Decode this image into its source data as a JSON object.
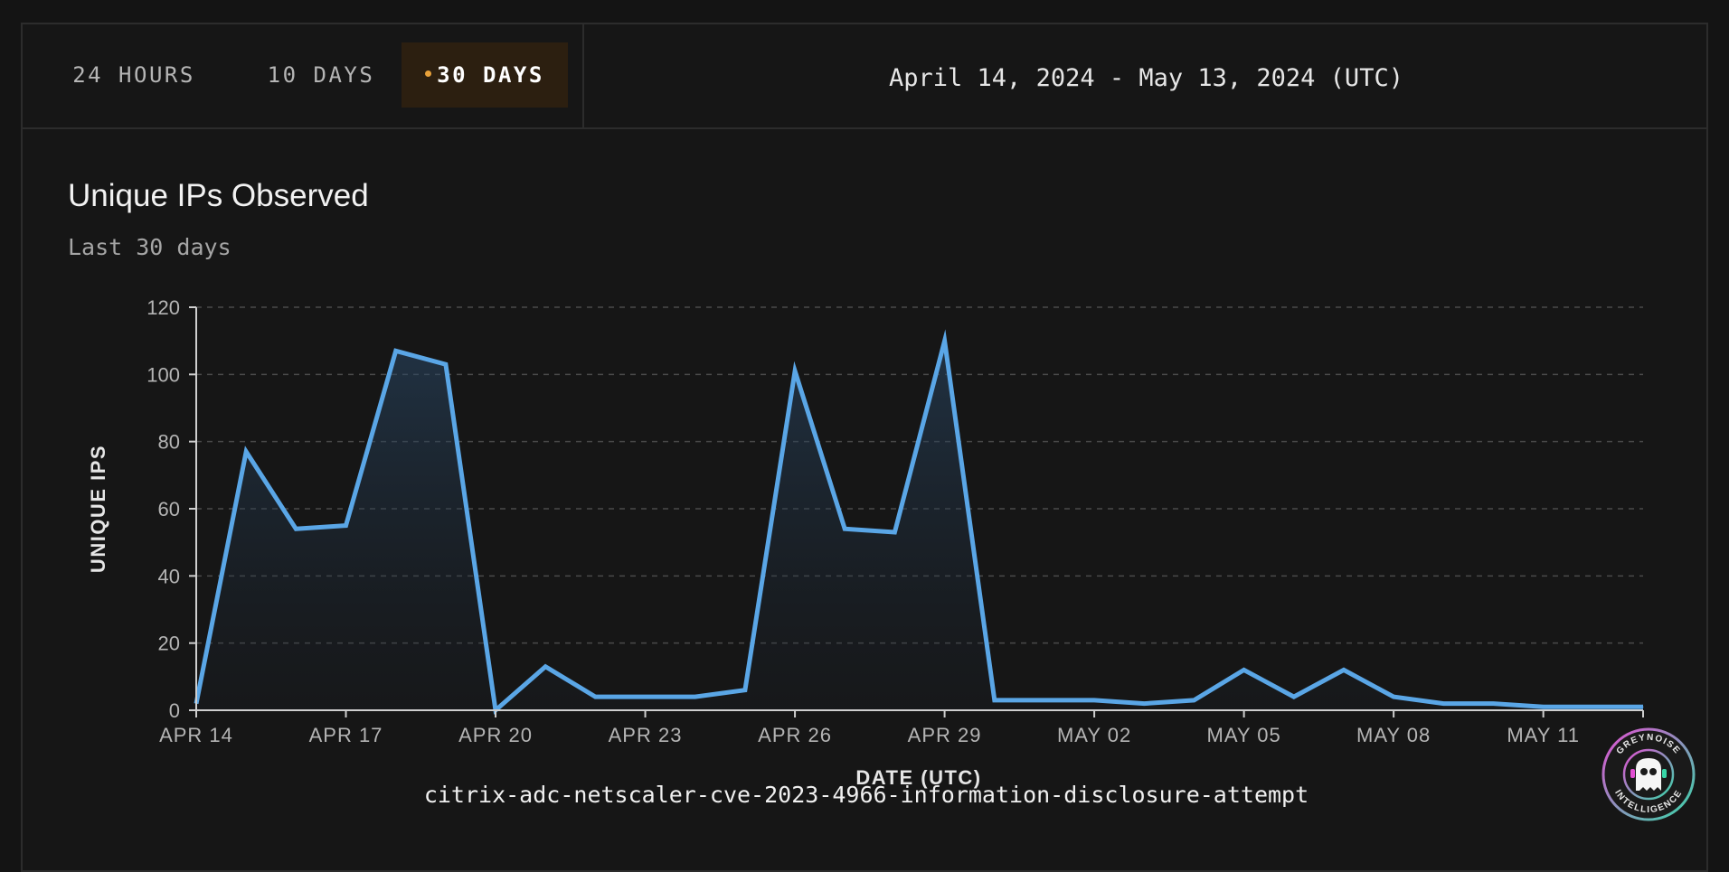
{
  "tabs": [
    {
      "label": "24 HOURS",
      "active": false
    },
    {
      "label": "10 DAYS",
      "active": false
    },
    {
      "label": "30 DAYS",
      "active": true
    }
  ],
  "date_range": "April 14, 2024 - May 13, 2024 (UTC)",
  "colors": {
    "accent": "#e8a13a",
    "line": "#5aa6e6",
    "grid": "#4a4a4a",
    "background": "#161616"
  },
  "logo": {
    "icon": "ghost-icon",
    "text_top": "GREYNOISE",
    "text_bottom": "INTELLIGENCE"
  },
  "chart_data": {
    "type": "area",
    "title": "Unique IPs Observed",
    "subtitle": "Last 30 days",
    "xlabel": "DATE (UTC)",
    "ylabel": "UNIQUE IPS",
    "series_caption": "citrix-adc-netscaler-cve-2023-4966-information-disclosure-attempt",
    "ylim": [
      0,
      120
    ],
    "yticks": [
      0,
      20,
      40,
      60,
      80,
      100,
      120
    ],
    "grid": true,
    "x_start": "2024-04-14",
    "x_end": "2024-05-13",
    "xticks": [
      {
        "date": "2024-04-14",
        "label": "APR 14"
      },
      {
        "date": "2024-04-17",
        "label": "APR 17"
      },
      {
        "date": "2024-04-20",
        "label": "APR 20"
      },
      {
        "date": "2024-04-23",
        "label": "APR 23"
      },
      {
        "date": "2024-04-26",
        "label": "APR 26"
      },
      {
        "date": "2024-04-29",
        "label": "APR 29"
      },
      {
        "date": "2024-05-02",
        "label": "MAY 02"
      },
      {
        "date": "2024-05-05",
        "label": "MAY 05"
      },
      {
        "date": "2024-05-08",
        "label": "MAY 08"
      },
      {
        "date": "2024-05-11",
        "label": "MAY 11"
      }
    ],
    "points": [
      {
        "date": "2024-04-14",
        "value": 2
      },
      {
        "date": "2024-04-15",
        "value": 77
      },
      {
        "date": "2024-04-16",
        "value": 54
      },
      {
        "date": "2024-04-17",
        "value": 55
      },
      {
        "date": "2024-04-18",
        "value": 107
      },
      {
        "date": "2024-04-19",
        "value": 103
      },
      {
        "date": "2024-04-20",
        "value": 0
      },
      {
        "date": "2024-04-21",
        "value": 13
      },
      {
        "date": "2024-04-22",
        "value": 4
      },
      {
        "date": "2024-04-23",
        "value": 4
      },
      {
        "date": "2024-04-24",
        "value": 4
      },
      {
        "date": "2024-04-25",
        "value": 6
      },
      {
        "date": "2024-04-26",
        "value": 101
      },
      {
        "date": "2024-04-27",
        "value": 54
      },
      {
        "date": "2024-04-28",
        "value": 53
      },
      {
        "date": "2024-04-29",
        "value": 110
      },
      {
        "date": "2024-04-30",
        "value": 3
      },
      {
        "date": "2024-05-01",
        "value": 3
      },
      {
        "date": "2024-05-02",
        "value": 3
      },
      {
        "date": "2024-05-03",
        "value": 2
      },
      {
        "date": "2024-05-04",
        "value": 3
      },
      {
        "date": "2024-05-05",
        "value": 12
      },
      {
        "date": "2024-05-06",
        "value": 4
      },
      {
        "date": "2024-05-07",
        "value": 12
      },
      {
        "date": "2024-05-08",
        "value": 4
      },
      {
        "date": "2024-05-09",
        "value": 2
      },
      {
        "date": "2024-05-10",
        "value": 2
      },
      {
        "date": "2024-05-11",
        "value": 1
      },
      {
        "date": "2024-05-12",
        "value": 1
      },
      {
        "date": "2024-05-13",
        "value": 1
      }
    ]
  }
}
